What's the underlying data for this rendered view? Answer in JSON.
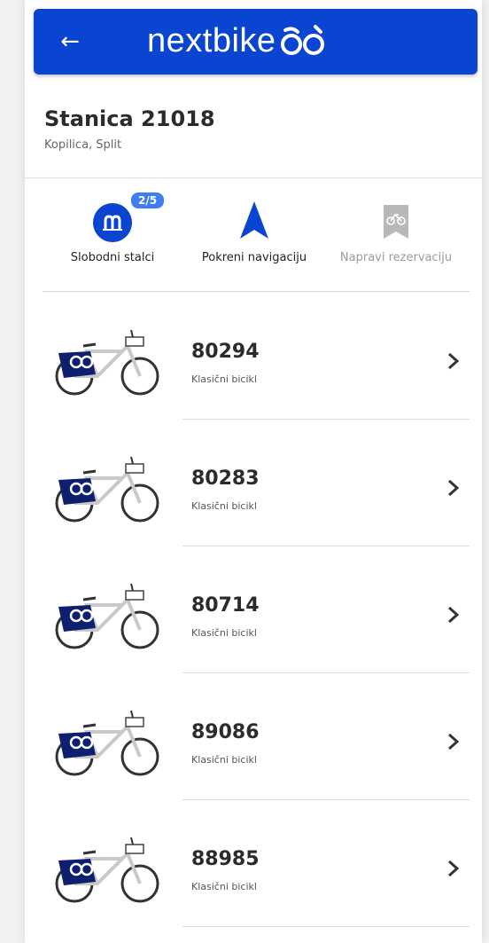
{
  "header": {
    "back_icon": "arrow-left-icon",
    "logo_text": "nextbike",
    "logo_mark": "nextbike-wheels-logo",
    "bar_color": "#0a45d1"
  },
  "station": {
    "title": "Stanica 21018",
    "subtitle": "Kopilica, Split"
  },
  "actions": [
    {
      "label": "Slobodni stalci",
      "icon": "bike-rack-icon",
      "badge": "2/5",
      "enabled": true
    },
    {
      "label": "Pokreni navigaciju",
      "icon": "navigation-arrow-icon",
      "enabled": true
    },
    {
      "label": "Napravi rezervaciju",
      "icon": "reserve-bookmark-icon",
      "enabled": false
    }
  ],
  "bikes": [
    {
      "id": "80294",
      "type": "Klasični bicikl"
    },
    {
      "id": "80283",
      "type": "Klasični bicikl"
    },
    {
      "id": "80714",
      "type": "Klasični bicikl"
    },
    {
      "id": "89086",
      "type": "Klasični bicikl"
    },
    {
      "id": "88985",
      "type": "Klasični bicikl"
    }
  ],
  "colors": {
    "brand_blue": "#0a45d1",
    "badge_blue": "#3e7ef1",
    "disabled_gray": "#9a9a9a"
  }
}
